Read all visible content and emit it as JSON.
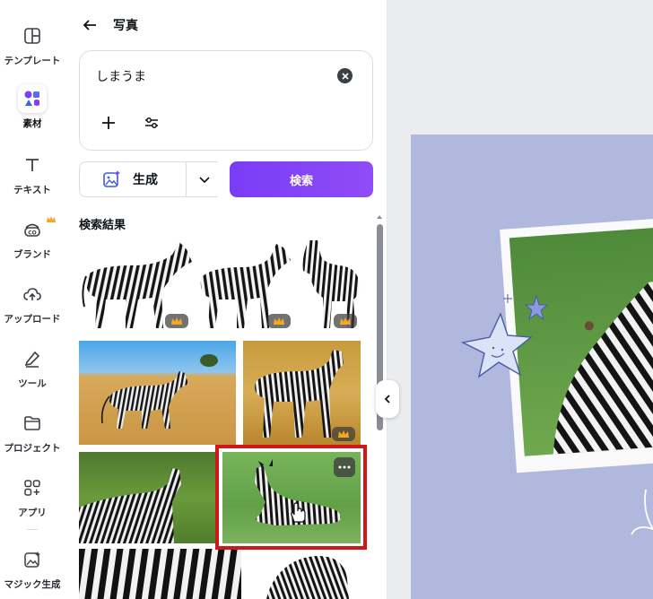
{
  "sidebar": {
    "items": [
      {
        "label": "テンプレート",
        "icon": "layout-icon"
      },
      {
        "label": "素材",
        "icon": "elements-icon"
      },
      {
        "label": "テキスト",
        "icon": "text-icon"
      },
      {
        "label": "ブランド",
        "icon": "brand-icon"
      },
      {
        "label": "アップロード",
        "icon": "upload-cloud-icon"
      },
      {
        "label": "ツール",
        "icon": "pen-tool-icon"
      },
      {
        "label": "プロジェクト",
        "icon": "folder-icon"
      },
      {
        "label": "アプリ",
        "icon": "apps-icon"
      },
      {
        "label": "マジック生成",
        "icon": "magic-image-icon"
      }
    ],
    "active_index": 1
  },
  "panel": {
    "title": "写真",
    "search_value": "しまうま",
    "generate_label": "生成",
    "search_label": "検索",
    "results_title": "検索結果"
  },
  "colors": {
    "accent": "#7d3ef6",
    "highlight": "#d01818",
    "canvas_page": "#b1b8de",
    "crown": "#f5a623"
  }
}
